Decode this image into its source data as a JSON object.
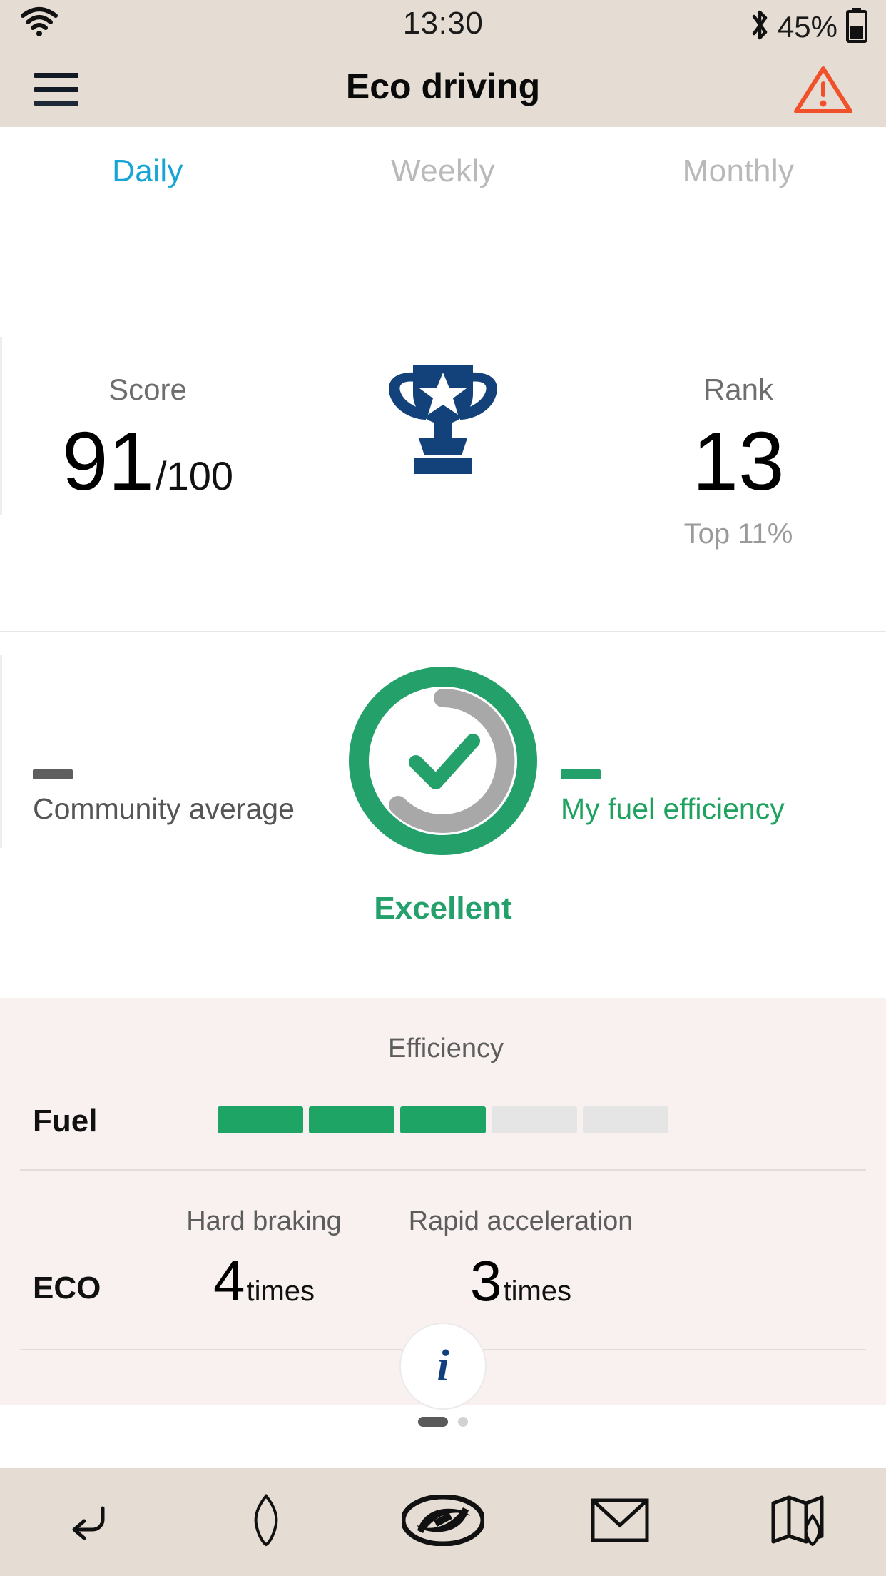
{
  "statusbar": {
    "time": "13:30",
    "battery_percent": "45%",
    "wifi_icon": "wifi-icon",
    "bluetooth_icon": "bluetooth-icon",
    "battery_icon": "battery-icon"
  },
  "header": {
    "title": "Eco driving",
    "menu_icon": "hamburger-menu-icon",
    "alert_icon": "warning-triangle-icon",
    "alert_color": "#f0502a",
    "background": "#e5dcd3"
  },
  "tabs": [
    {
      "label": "Daily",
      "active": true
    },
    {
      "label": "Weekly",
      "active": false
    },
    {
      "label": "Monthly",
      "active": false
    }
  ],
  "score_card": {
    "score_label": "Score",
    "score_value": "91",
    "score_suffix": "/100",
    "trophy_icon": "trophy-icon",
    "trophy_color": "#13427a",
    "rank_label": "Rank",
    "rank_value": "13",
    "rank_note": "Top 11%"
  },
  "gauge_card": {
    "legend_left_label": "Community average",
    "legend_left_color": "#5e5e5e",
    "legend_right_label": "My fuel efficiency",
    "legend_right_color": "#24a06a",
    "status_label": "Excellent",
    "check_icon": "checkmark-icon",
    "ring_color": "#24a06a",
    "track_color": "#a8a8a8"
  },
  "stats": {
    "fuel": {
      "row_label": "Fuel",
      "metric_title": "Efficiency",
      "segments_total": 5,
      "segments_filled": 3,
      "filled_color": "#1ea566",
      "empty_color": "#e5e5e5"
    },
    "eco": {
      "row_label": "ECO",
      "metrics": [
        {
          "title": "Hard braking",
          "value": "4",
          "unit": "times"
        },
        {
          "title": "Rapid acceleration",
          "value": "3",
          "unit": "times"
        }
      ]
    },
    "info_button_label": "i"
  },
  "pager": {
    "pages": 2,
    "active_index": 0
  },
  "bottom_nav": [
    {
      "name": "back-icon",
      "label": "Back"
    },
    {
      "name": "location-pin-icon",
      "label": "Location"
    },
    {
      "name": "hyundai-logo-icon",
      "label": "Hyundai"
    },
    {
      "name": "mail-icon",
      "label": "Mail"
    },
    {
      "name": "map-icon",
      "label": "Map"
    }
  ]
}
